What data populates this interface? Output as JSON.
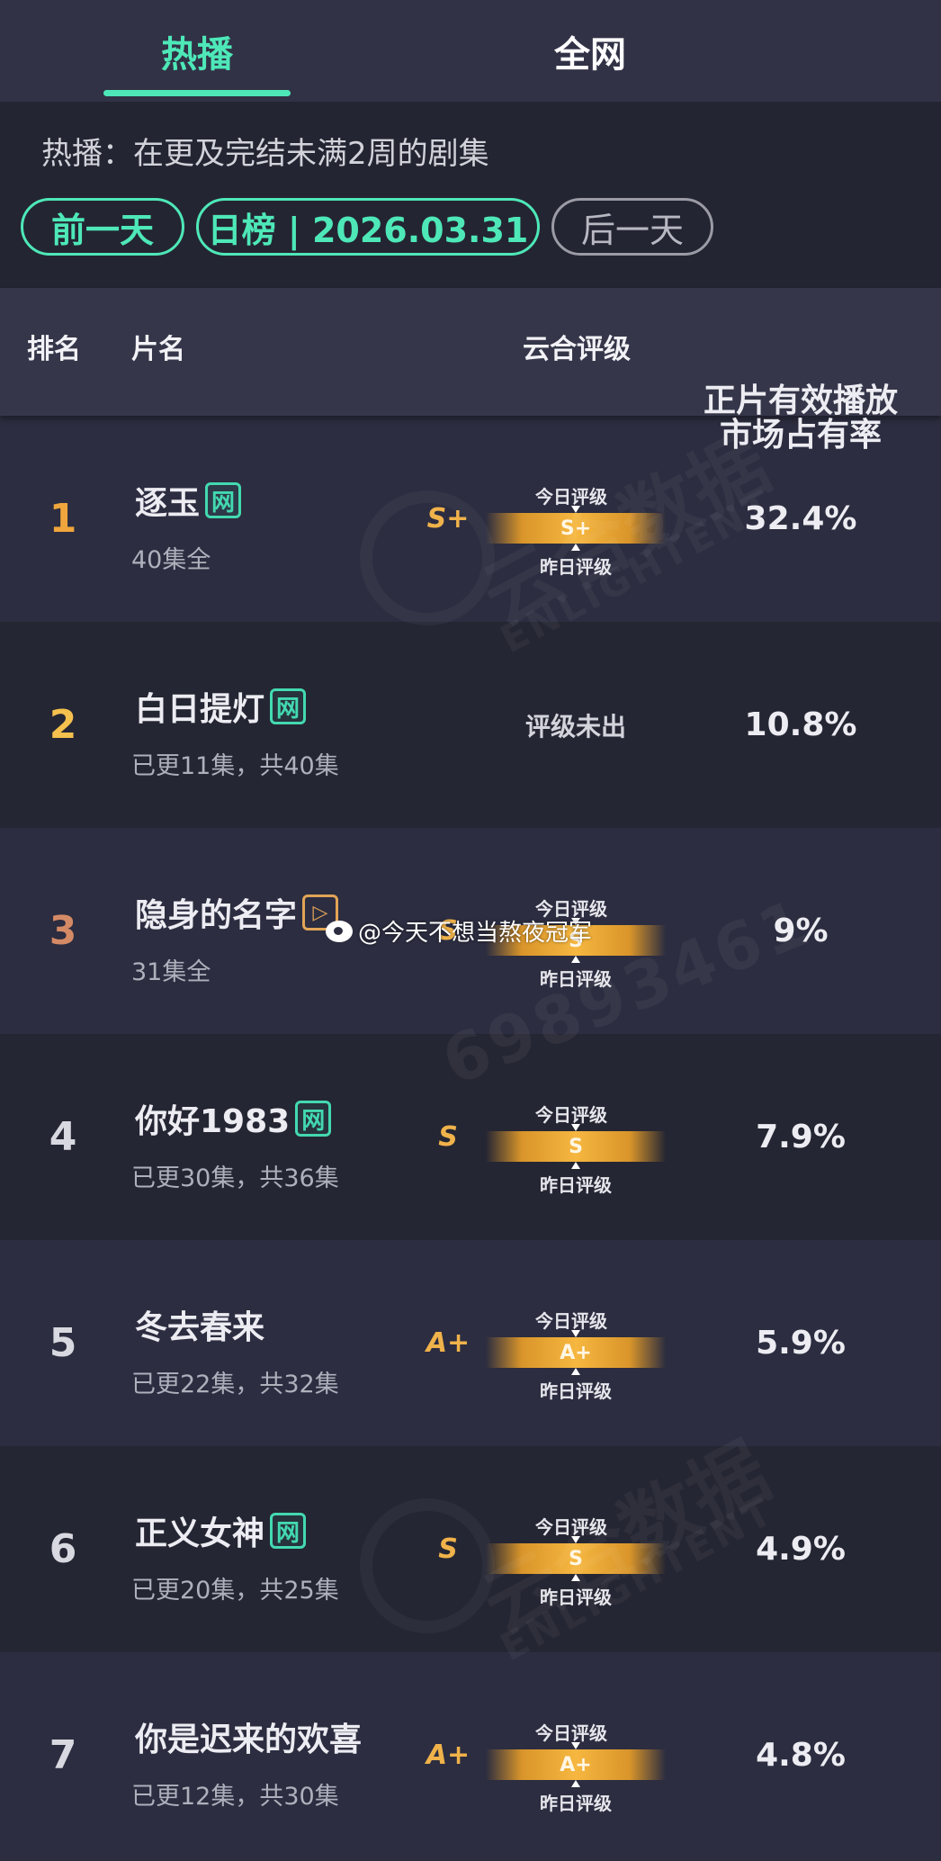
{
  "tabs": [
    {
      "label": "热播",
      "active": true
    },
    {
      "label": "全网",
      "active": false
    }
  ],
  "description": "热播：在更及完结未满2周的剧集",
  "date_nav": {
    "prev_label": "前一天",
    "current_label": "日榜 | 2026.03.31",
    "next_label": "后一天"
  },
  "table_header": {
    "rank": "排名",
    "name": "片名",
    "rating": "云合评级",
    "share": "正片有效播放\n市场占有率"
  },
  "rating_labels": {
    "today": "今日评级",
    "yesterday": "昨日评级"
  },
  "colors": {
    "accent": "#4ee8b8",
    "rank_gold": "#f0a63c",
    "rank_yellow": "#f4c04e",
    "rank_bronze": "#d58a66",
    "rank_default": "#d8d8e0",
    "grade": "#f0b24a"
  },
  "rows": [
    {
      "rank": "1",
      "title": "逐玉",
      "badge": "网",
      "badge_type": "wang",
      "episodes": "40集全",
      "grade_yesterday": "S+",
      "grade_today": "S+",
      "share": "32.4%"
    },
    {
      "rank": "2",
      "title": "白日提灯",
      "badge": "网",
      "badge_type": "wang",
      "episodes": "已更11集，共40集",
      "no_rating": "评级未出",
      "share": "10.8%"
    },
    {
      "rank": "3",
      "title": "隐身的名字",
      "badge": "▷",
      "badge_type": "play",
      "episodes": "31集全",
      "grade_yesterday": "S",
      "grade_today": "S",
      "share": "9%"
    },
    {
      "rank": "4",
      "title": "你好1983",
      "badge": "网",
      "badge_type": "wang",
      "episodes": "已更30集，共36集",
      "grade_yesterday": "S",
      "grade_today": "S",
      "share": "7.9%"
    },
    {
      "rank": "5",
      "title": "冬去春来",
      "badge": "",
      "badge_type": "none",
      "episodes": "已更22集，共32集",
      "grade_yesterday": "A+",
      "grade_today": "A+",
      "share": "5.9%"
    },
    {
      "rank": "6",
      "title": "正义女神",
      "badge": "网",
      "badge_type": "wang",
      "episodes": "已更20集，共25集",
      "grade_yesterday": "S",
      "grade_today": "S",
      "share": "4.9%"
    },
    {
      "rank": "7",
      "title": "你是迟来的欢喜",
      "badge": "",
      "badge_type": "none",
      "episodes": "已更12集，共30集",
      "grade_yesterday": "A+",
      "grade_today": "A+",
      "share": "4.8%"
    }
  ],
  "watermarks": {
    "brand": "云合数据",
    "brand_en": "ENLIGHTENT",
    "id_fragment": "69893461",
    "weibo": "@今天不想当熬夜冠军"
  }
}
